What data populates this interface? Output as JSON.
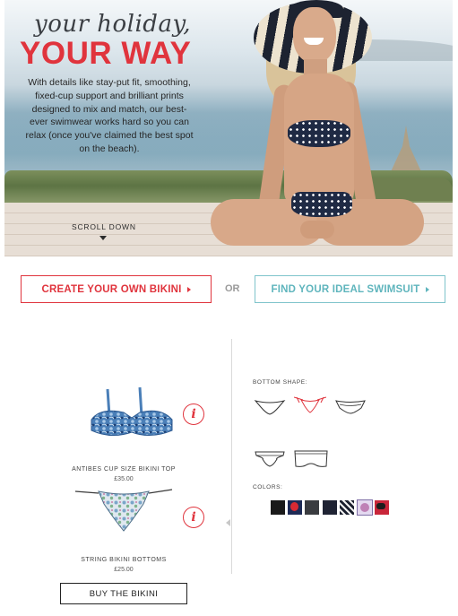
{
  "hero": {
    "title_script": "your holiday,",
    "title_bold": "YOUR WAY",
    "intro": "With details like stay-put fit, smoothing, fixed-cup support and brilliant prints designed to mix and match, our best-ever swimwear works hard so you can relax (once you've claimed the best spot on the beach).",
    "scroll_label": "SCROLL DOWN"
  },
  "cta": {
    "create_label": "CREATE YOUR OWN BIKINI",
    "or_label": "OR",
    "find_label": "FIND YOUR IDEAL SWIMSUIT"
  },
  "products": [
    {
      "name": "ANTIBES CUP SIZE BIKINI TOP",
      "price": "£35.00",
      "icon": "info-icon"
    },
    {
      "name": "STRING BIKINI BOTTOMS",
      "price": "£25.00",
      "icon": "info-icon"
    }
  ],
  "info_glyph": "i",
  "buy_label": "BUY THE BIKINI",
  "options": {
    "bottom_shape_label": "BOTTOM SHAPE:",
    "colors_label": "COLORS:",
    "selected_shape": "string",
    "colors": [
      "#1a1a1a",
      "#1d2a55",
      "#3a3c40",
      "#1f2333",
      "#1a1f2e",
      "#e4d9f0",
      "#c9263a"
    ]
  },
  "colors": {
    "accent_red": "#e0343d",
    "accent_teal": "#5fb5bd"
  }
}
